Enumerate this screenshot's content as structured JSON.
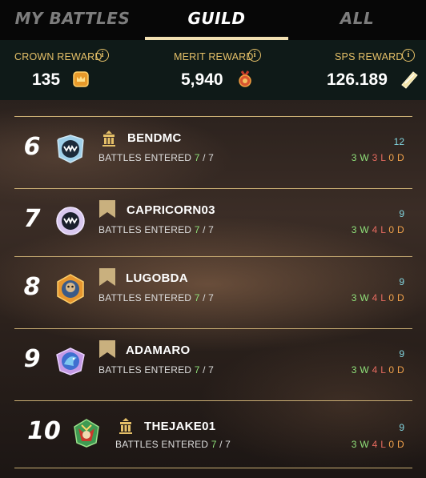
{
  "tabs": [
    {
      "label": "MY BATTLES",
      "active": false
    },
    {
      "label": "GUILD",
      "active": true
    },
    {
      "label": "ALL",
      "active": false
    }
  ],
  "rewards": {
    "crown": {
      "label": "CROWN REWARD",
      "value": "135",
      "icon": "crown-token-icon"
    },
    "merit": {
      "label": "MERIT REWARD",
      "value": "5,940",
      "icon": "merit-medal-icon"
    },
    "sps": {
      "label": "SPS REWARD",
      "value": "126.189",
      "icon": "sps-crystal-icon"
    }
  },
  "players": [
    {
      "rank": "6",
      "name": "BENDMC",
      "battles_label": "BATTLES ENTERED",
      "entered": "7",
      "total": "7",
      "score": "12",
      "w": "3 W",
      "l": "3 L",
      "d": "0 D",
      "badge": "guild-building-icon",
      "avatar": "monster-avatar-icon"
    },
    {
      "rank": "7",
      "name": "CAPRICORN03",
      "battles_label": "BATTLES ENTERED",
      "entered": "7",
      "total": "7",
      "score": "9",
      "w": "3 W",
      "l": "4 L",
      "d": "0 D",
      "badge": "banner-flag-icon",
      "avatar": "monster-avatar-icon"
    },
    {
      "rank": "8",
      "name": "LUGOBDA",
      "battles_label": "BATTLES ENTERED",
      "entered": "7",
      "total": "7",
      "score": "9",
      "w": "3 W",
      "l": "4 L",
      "d": "0 D",
      "badge": "banner-flag-icon",
      "avatar": "creature-avatar-icon"
    },
    {
      "rank": "9",
      "name": "ADAMARO",
      "battles_label": "BATTLES ENTERED",
      "entered": "7",
      "total": "7",
      "score": "9",
      "w": "3 W",
      "l": "4 L",
      "d": "0 D",
      "badge": "banner-flag-icon",
      "avatar": "dragon-avatar-icon"
    },
    {
      "rank": "10",
      "name": "THEJAKE01",
      "battles_label": "BATTLES ENTERED",
      "entered": "7",
      "total": "7",
      "score": "9",
      "w": "3 W",
      "l": "4 L",
      "d": "0 D",
      "badge": "guild-building-icon",
      "avatar": "jester-avatar-icon"
    }
  ],
  "colors": {
    "accent_gold": "#e5c068",
    "win_green": "#8fe07a",
    "loss_red": "#e56a5f",
    "draw_orange": "#f2a24b",
    "score_cyan": "#82d6e0"
  }
}
